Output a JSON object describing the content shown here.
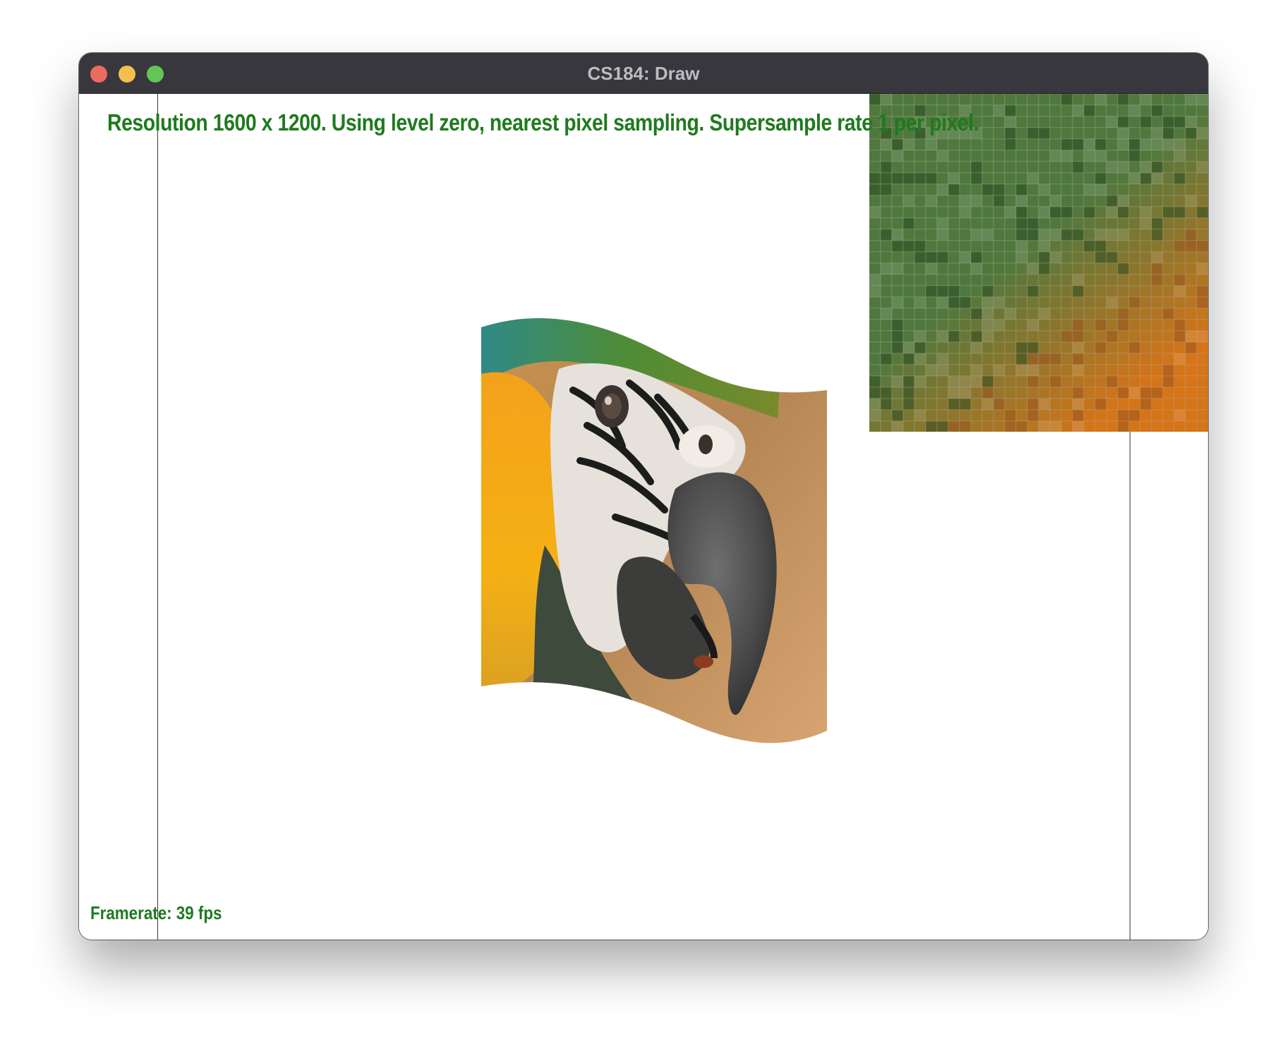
{
  "window": {
    "title": "CS184: Draw",
    "traffic_lights": [
      {
        "name": "close",
        "color": "#ed6a5e"
      },
      {
        "name": "minimize",
        "color": "#f5bf4f"
      },
      {
        "name": "zoom",
        "color": "#62c554"
      }
    ]
  },
  "overlay": {
    "status_text": "Resolution 1600 x 1200. Using level zero, nearest pixel sampling. Supersample rate 1 per pixel.",
    "framerate_text": "Framerate: 39 fps",
    "text_color": "#1f7a1f"
  },
  "scene": {
    "image_subject": "parrot (macaw) head texture on a waving quad",
    "zoom_inset": "magnified pixel grid of green and orange feathers"
  }
}
